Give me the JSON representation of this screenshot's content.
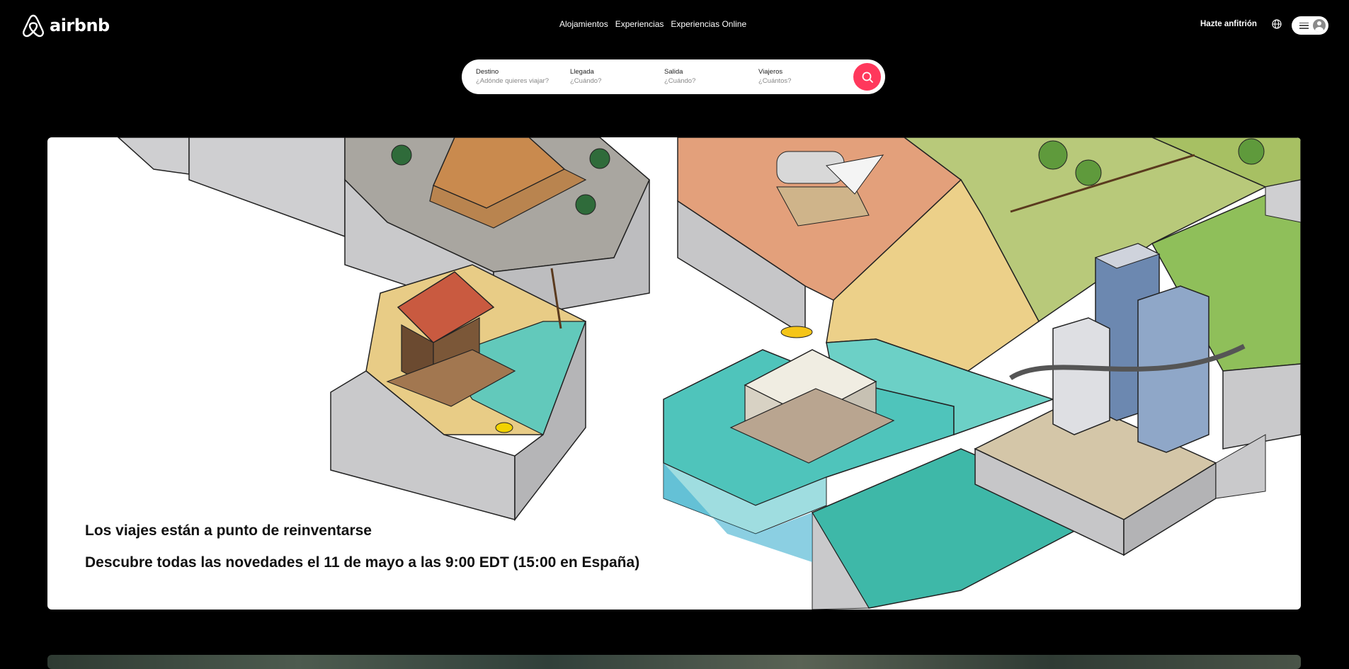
{
  "header": {
    "logo_text": "airbnb",
    "nav": [
      "Alojamientos",
      "Experiencias",
      "Experiencias Online"
    ],
    "host_link": "Hazte anfitrión"
  },
  "search": {
    "fields": [
      {
        "label": "Destino",
        "placeholder": "¿Adónde quieres viajar?"
      },
      {
        "label": "Llegada",
        "placeholder": "¿Cuándo?"
      },
      {
        "label": "Salida",
        "placeholder": "¿Cuándo?"
      },
      {
        "label": "Viajeros",
        "placeholder": "¿Cuántos?"
      }
    ],
    "button_color": "#ff385c"
  },
  "hero": {
    "title": "Los viajes están a punto de reinventarse",
    "subtitle": "Descubre todas las novedades el 11 de mayo a las 9:00 EDT (15:00 en España)"
  },
  "colors": {
    "background": "#000000",
    "accent": "#ff385c"
  },
  "icons": [
    "airbnb-logo-icon",
    "globe-icon",
    "menu-icon",
    "user-avatar-icon",
    "search-icon"
  ]
}
